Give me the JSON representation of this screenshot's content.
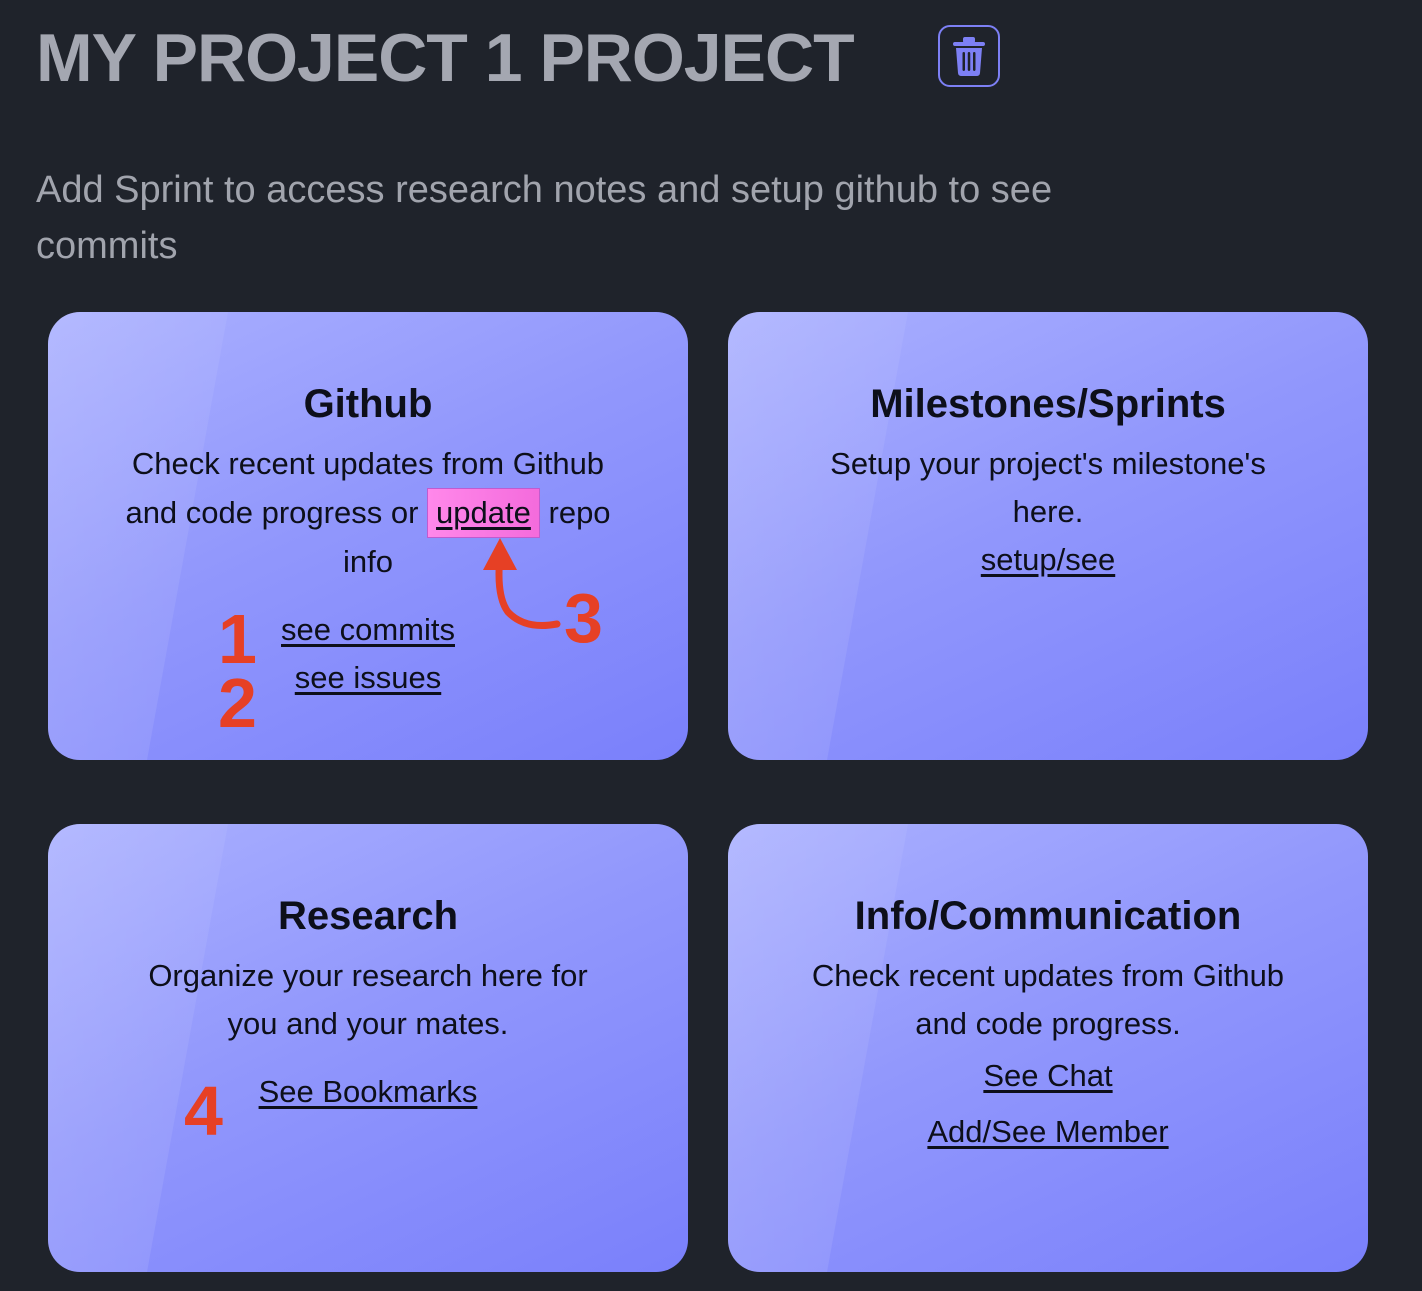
{
  "header": {
    "title": "MY PROJECT 1 PROJECT",
    "delete_icon": "trash-icon"
  },
  "subtitle": "Add Sprint to access research notes and setup github to see commits",
  "cards": {
    "github": {
      "title": "Github",
      "desc_before": "Check recent updates from Github and code progress or",
      "update_link": "update",
      "desc_after": "repo info",
      "see_commits": "see commits",
      "see_issues": "see issues"
    },
    "milestones": {
      "title": "Milestones/Sprints",
      "desc": "Setup your project's milestone's here.",
      "setup_link": "setup/see"
    },
    "research": {
      "title": "Research",
      "desc": "Organize your research here for you and your mates.",
      "bookmarks_link": "See Bookmarks"
    },
    "info": {
      "title": "Info/Communication",
      "desc": "Check recent updates from Github and code progress.",
      "chat_link": "See Chat",
      "member_link": "Add/See Member"
    }
  },
  "annotations": {
    "one": "1",
    "two": "2",
    "three": "3",
    "four": "4"
  },
  "colors": {
    "background": "#1f232b",
    "title": "#a4a7b1",
    "accent": "#7d80f5",
    "annotation": "#e64025",
    "highlight": "#ff88ea"
  }
}
